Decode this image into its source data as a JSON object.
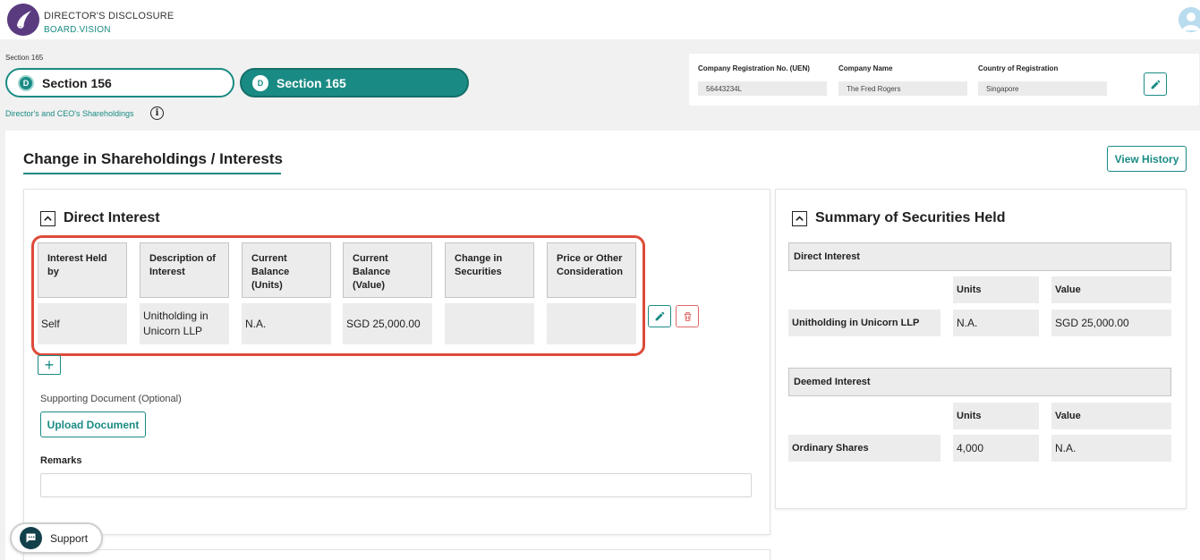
{
  "header": {
    "app_title": "DIRECTOR'S DISCLOSURE",
    "app_subtitle": "BOARD.VISION"
  },
  "section_switch": {
    "caption": "Section 165",
    "badge_letter": "D",
    "items": [
      {
        "label": "Section 156",
        "active": false
      },
      {
        "label": "Section 165",
        "active": true
      }
    ],
    "link_label": "Director's and CEO's Shareholdings",
    "info_glyph": "i"
  },
  "company": {
    "uen_label": "Company Registration No. (UEN)",
    "uen_value": "56443234L",
    "name_label": "Company Name",
    "name_value": "The Fred Rogers",
    "country_label": "Country of Registration",
    "country_value": "Singapore"
  },
  "main": {
    "title": "Change in Shareholdings / Interests",
    "view_history_label": "View History"
  },
  "direct_interest": {
    "title": "Direct Interest",
    "columns": [
      "Interest Held by",
      "Description of Interest",
      "Current Balance (Units)",
      "Current Balance (Value)",
      "Change in Securities",
      "Price or Other Consideration"
    ],
    "rows": [
      [
        "Self",
        "Unitholding in Unicorn LLP",
        "N.A.",
        "SGD 25,000.00",
        "",
        ""
      ]
    ],
    "add_glyph": "+",
    "supporting_doc_label": "Supporting Document (Optional)",
    "upload_label": "Upload Document",
    "remarks_label": "Remarks",
    "remarks_value": ""
  },
  "summary": {
    "title": "Summary of Securities Held",
    "units_label": "Units",
    "value_label": "Value",
    "groups": [
      {
        "heading": "Direct Interest",
        "item": "Unitholding in Unicorn LLP",
        "units": "N.A.",
        "value": "SGD 25,000.00"
      },
      {
        "heading": "Deemed Interest",
        "item": "Ordinary Shares",
        "units": "4,000",
        "value": "N.A."
      }
    ]
  },
  "support": {
    "label": "Support"
  },
  "colors": {
    "accent": "#1a8b84",
    "highlight": "#dd4b39",
    "delete": "#e06666",
    "logo": "#5b3b80"
  }
}
